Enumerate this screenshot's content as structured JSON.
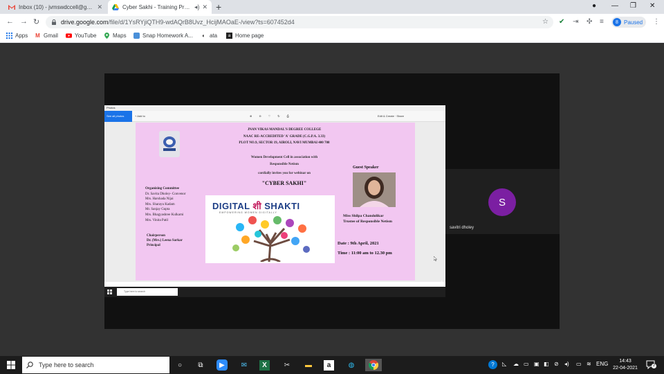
{
  "browser": {
    "tabs": [
      {
        "title": "Inbox (10) - jvmswdccell@gmail.",
        "icon": "gmail-icon",
        "active": false
      },
      {
        "title": "Cyber Sakhi - Training Progr",
        "icon": "drive-icon",
        "active": true
      }
    ],
    "new_tab": "+",
    "url_host": "drive.google.com",
    "url_path": "/file/d/1YsRYjiQTH9-wdAQrB8Uvz_HcijMAOaE-/view?ts=607452d4",
    "profile_initial": "8",
    "profile_status": "Paused",
    "bookmarks": [
      "Apps",
      "Gmail",
      "YouTube",
      "Maps",
      "Snap Homework A...",
      "ata",
      "Home page"
    ]
  },
  "shared_screen": {
    "toolbar_button": "See all photos",
    "toolbar_add": "+ Add to",
    "toolbar_right": "Edit & Create  ·  Share",
    "taskbar_search": "Type here to search",
    "poster": {
      "college": "JNAN VIKAS MANDAL'S DEGREE COLLEGE",
      "naac": "NAAC RE-ACCREDITED 'A' GRADE (C.G.P.A. 3.33)",
      "address": "PLOT NO.9, SECTOR 19, AIROLI, NAVI MUMBAI 400 708",
      "invite_line1": "Women Development Cell in association with",
      "invite_line2": "Responsible Netism",
      "invite_line3": "cordially invites you for webinar on",
      "event_title": "\"CYBER SAKHI\"",
      "committee_heading": "Organizing Committee",
      "committee": [
        "Dr. Savita Dholey- Convenor",
        "Mrs. Harshada Nijai",
        "Mrs. Sharayu Kadam",
        "Mr. Sanjay Gupta",
        "Mrs. Bhagyashree Kulkarni",
        "Mrs. Vinita Patil"
      ],
      "chair_title": "Chairperson",
      "chair_name": "Dr. (Mrs.) Leena Sarkar",
      "chair_role": "Principal",
      "digital_title_a": "DIGITAL ",
      "digital_title_b": "शी",
      "digital_title_c": " SHAKTI",
      "digital_subtitle": "EMPOWERING WOMEN DIGITALLY",
      "guest_heading": "Guest Speaker",
      "guest_name": "Miss Shilpa Chandolikar",
      "guest_role": "Trustee of Responsible Netism",
      "date": "Date : 9th April, 2021",
      "time": "Time : 11:00 am to 12.30 pm"
    }
  },
  "participant": {
    "initial": "S",
    "name": "savitri dholey",
    "color": "#7b1fa2"
  },
  "windows_taskbar": {
    "search_placeholder": "Type here to search",
    "language": "ENG",
    "time": "14:43",
    "date": "22-04-2021",
    "notifications": "2"
  }
}
